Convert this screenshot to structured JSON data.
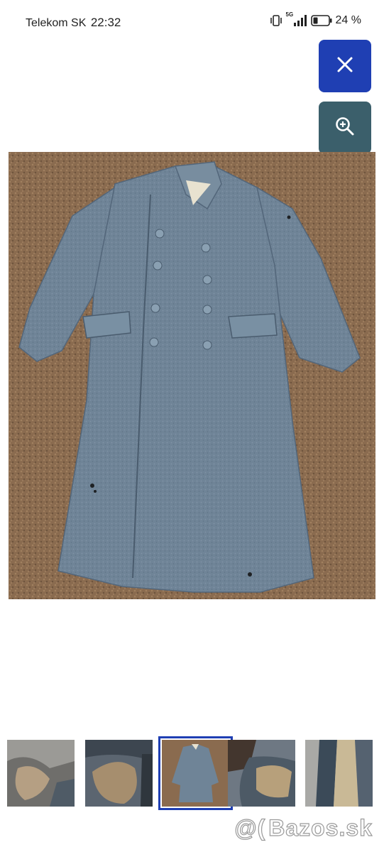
{
  "status_bar": {
    "carrier": "Telekom SK",
    "time": "22:32",
    "network": "5G",
    "battery": "24 %"
  },
  "actions": {
    "close_icon": "close-icon",
    "zoom_icon": "zoom-in-icon"
  },
  "gallery": {
    "main_image": "coat-photo",
    "thumbnails": [
      {
        "subject": "damaged-fabric-closeup"
      },
      {
        "subject": "lining-patch-closeup"
      },
      {
        "subject": "coat-full-view",
        "selected": true
      },
      {
        "subject": "boot-closeup"
      },
      {
        "subject": "seam-closeup"
      }
    ]
  },
  "watermark": {
    "text": "Bazos.sk"
  },
  "colors": {
    "close_button": "#1f3fb3",
    "zoom_button": "#3b5f6b",
    "coat": "#6f8497",
    "carpet": "#8a6b4f"
  }
}
